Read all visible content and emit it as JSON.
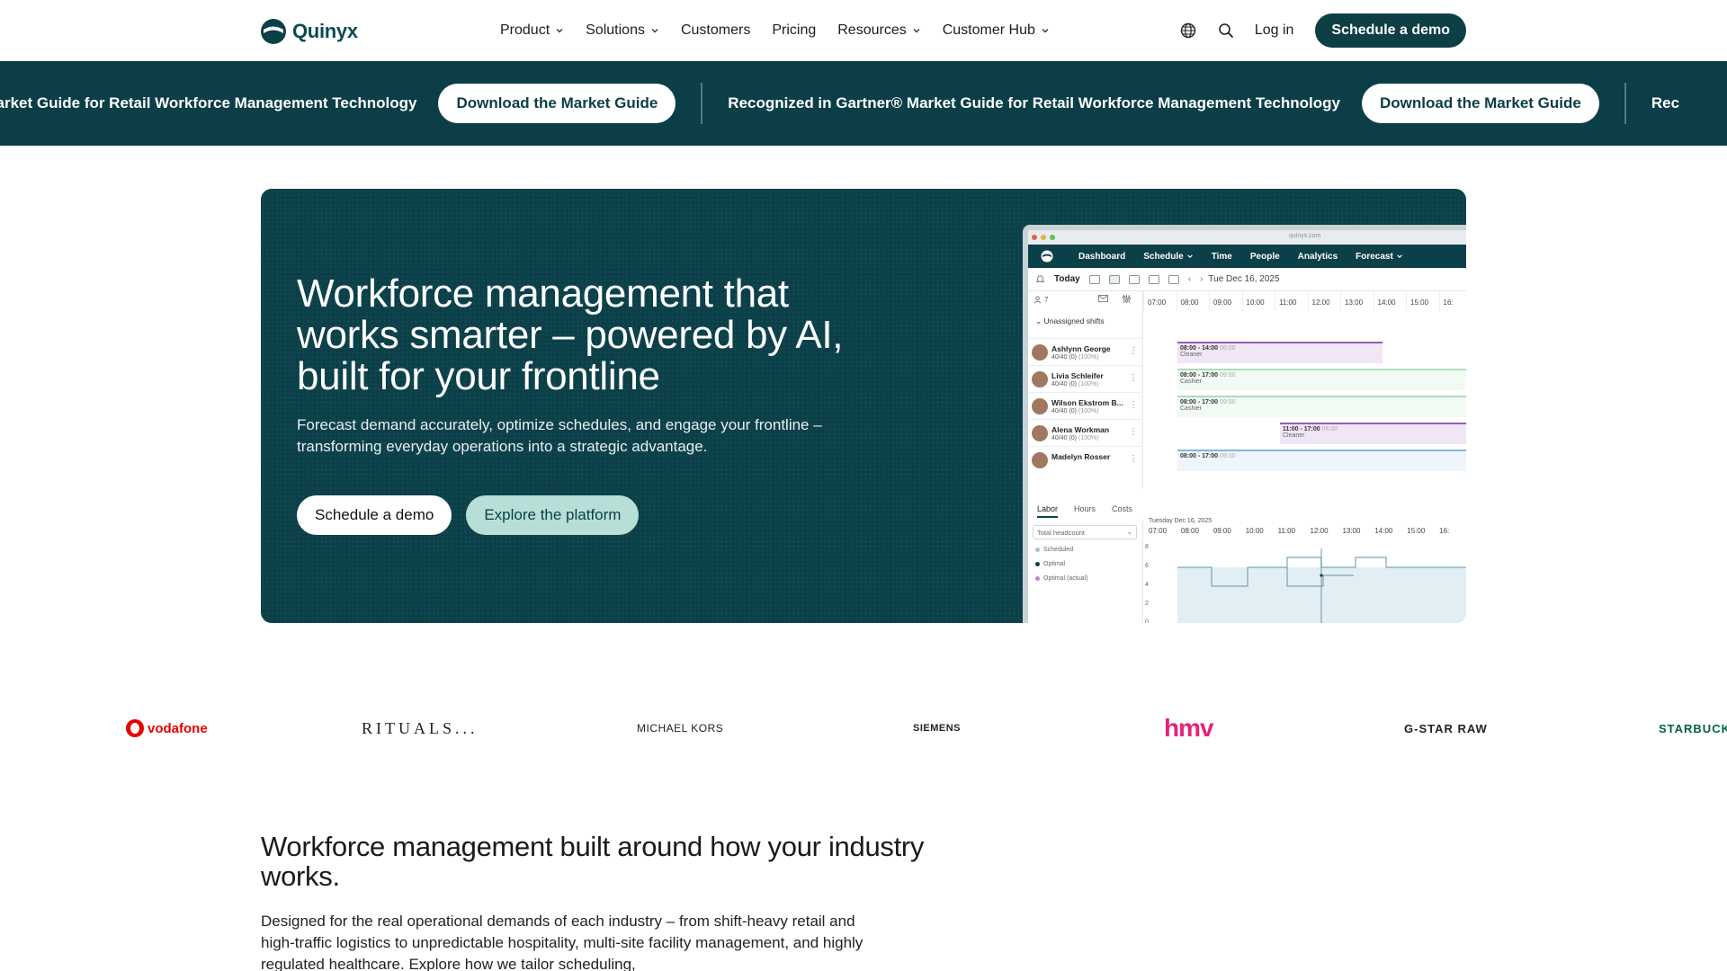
{
  "brand": {
    "name": "Quinyx",
    "primary": "#0c4049",
    "accent": "#b7ded7"
  },
  "nav": {
    "items": [
      {
        "label": "Product",
        "has_dropdown": true
      },
      {
        "label": "Solutions",
        "has_dropdown": true
      },
      {
        "label": "Customers",
        "has_dropdown": false
      },
      {
        "label": "Pricing",
        "has_dropdown": false
      },
      {
        "label": "Resources",
        "has_dropdown": true
      },
      {
        "label": "Customer Hub",
        "has_dropdown": true
      }
    ],
    "globe_icon": "globe-icon",
    "search_icon": "search-icon",
    "login": "Log in",
    "cta": "Schedule a demo"
  },
  "banner": {
    "text_partial": "tner® Market Guide for Retail Workforce Management Technology",
    "text": "Recognized in Gartner® Market Guide for Retail Workforce Management Technology",
    "text_tail": "Rec",
    "button": "Download the Market Guide"
  },
  "hero": {
    "title": "Workforce management that works smarter – powered by AI, built for your frontline",
    "subtitle": "Forecast demand accurately, optimize schedules, and engage your frontline – transforming everyday operations into a strategic advantage.",
    "primary_button": "Schedule a demo",
    "secondary_button": "Explore the platform"
  },
  "mockup": {
    "url": "quinyx.com",
    "tabs": [
      {
        "label": "Dashboard",
        "dropdown": false
      },
      {
        "label": "Schedule",
        "dropdown": true
      },
      {
        "label": "Time",
        "dropdown": false
      },
      {
        "label": "People",
        "dropdown": false
      },
      {
        "label": "Analytics",
        "dropdown": false
      },
      {
        "label": "Forecast",
        "dropdown": true
      }
    ],
    "today": "Today",
    "date": "Tue Dec 16, 2025",
    "people_count": "7",
    "unassigned": "Unassigned shifts",
    "hours": [
      "07:00",
      "08:00",
      "09:00",
      "10:00",
      "11:00",
      "12:00",
      "13:00",
      "14:00",
      "15:00",
      "16:"
    ],
    "employees": [
      {
        "name": "Ashlynn George",
        "hours": "40/40 (0)",
        "pct": "(100%)",
        "shift": "08:00 - 14:00",
        "dur": "06:00",
        "role": "Cleaner",
        "color": "#9b59b6",
        "fill": "#f1e6f6",
        "start": 8,
        "end": 14
      },
      {
        "name": "Livia Schleifer",
        "hours": "40/40 (0)",
        "pct": "(100%)",
        "shift": "08:00 - 17:00",
        "dur": "09:00",
        "role": "Cashier",
        "color": "#a9dfb5",
        "fill": "#f2faf4",
        "start": 8,
        "end": 17
      },
      {
        "name": "Wilson Ekstrom B...",
        "hours": "40/40 (0)",
        "pct": "(100%)",
        "shift": "08:00 - 17:00",
        "dur": "09:00",
        "role": "Cashier",
        "color": "#a9dfb5",
        "fill": "#f2faf4",
        "start": 8,
        "end": 17
      },
      {
        "name": "Alena Workman",
        "hours": "40/40 (0)",
        "pct": "(100%)",
        "shift": "11:00 - 17:00",
        "dur": "06:00",
        "role": "Cleaner",
        "color": "#9b59b6",
        "fill": "#f1e6f6",
        "start": 11,
        "end": 17
      },
      {
        "name": "Madelyn Rosser",
        "hours": "",
        "pct": "",
        "shift": "08:00 - 17:00",
        "dur": "09:00",
        "role": "",
        "color": "#7fb8d6",
        "fill": "#eef6fb",
        "start": 8,
        "end": 17
      }
    ],
    "bottom_tabs": [
      "Labor",
      "Hours",
      "Costs"
    ],
    "select": "Total headcount",
    "legend": [
      {
        "label": "Scheduled",
        "color": "#9fc6c0"
      },
      {
        "label": "Optimal",
        "color": "#0c4049"
      },
      {
        "label": "Optimal (actual)",
        "color": "#b58fc4"
      }
    ],
    "chart_date": "Tuesday Dec 16, 2025",
    "y_ticks": [
      "8",
      "6",
      "4",
      "2",
      "0"
    ]
  },
  "logos": [
    "vodafone",
    "RITUALS...",
    "MICHAEL KORS",
    "SIEMENS",
    "hmv",
    "G-STAR RAW",
    "STARBUCK"
  ],
  "section": {
    "title": "Workforce management built around how your industry works.",
    "body": "Designed for the real operational demands of each industry – from shift-heavy retail and high-traffic logistics to unpredictable hospitality, multi-site facility management, and highly regulated healthcare. Explore how we tailor scheduling,"
  }
}
